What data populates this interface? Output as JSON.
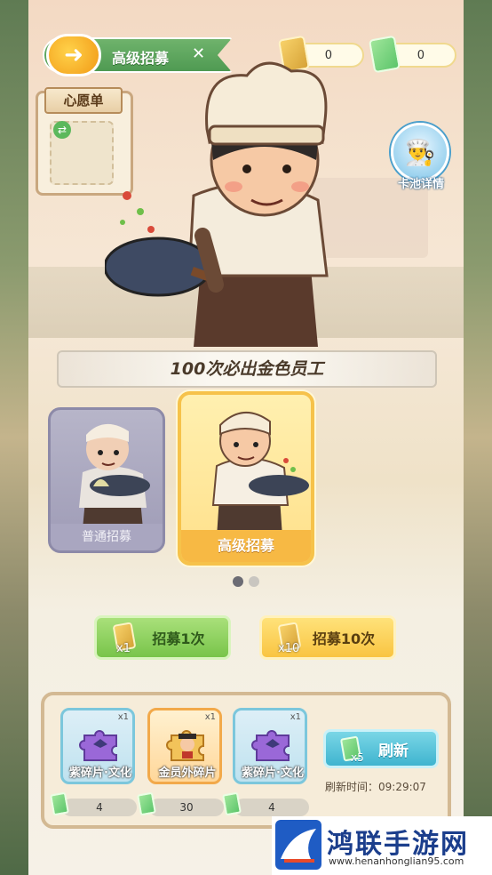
{
  "header": {
    "title": "高级招募",
    "back_icon": "fish-back-arrow-icon",
    "deco_icon": "utensils-icon"
  },
  "currency": {
    "gold_ticket_count": "0",
    "green_ticket_count": "0"
  },
  "wishlist": {
    "title": "心愿单",
    "swap_icon": "swap-icon"
  },
  "pool_detail": {
    "label": "卡池详情"
  },
  "banner": {
    "text": "100次必出金色员工"
  },
  "recruit_cards": {
    "normal": {
      "label": "普通招募"
    },
    "advanced": {
      "label": "高级招募"
    }
  },
  "pager": {
    "total": 2,
    "active": 0
  },
  "buttons": {
    "one": {
      "label": "招募1次",
      "qty": "x1"
    },
    "ten": {
      "label": "招募10次",
      "qty": "x10"
    }
  },
  "shop": {
    "items": [
      {
        "name": "紫碎片·文化",
        "count": "x1",
        "price": "4",
        "kind": "purple-puzzle-icon"
      },
      {
        "name": "金员外碎片",
        "count": "x1",
        "price": "30",
        "kind": "gold-employee-portrait-icon"
      },
      {
        "name": "紫碎片·文化",
        "count": "x1",
        "price": "4",
        "kind": "purple-puzzle-icon"
      }
    ],
    "refresh": {
      "label": "刷新",
      "qty": "x5"
    },
    "refresh_time": "刷新时间：09:29:07"
  },
  "watermark": {
    "title": "鸿联手游网",
    "url": "www.henanhonglian95.com"
  },
  "colors": {
    "green": "#78c44a",
    "gold": "#f9c441",
    "teal": "#3fb4cf",
    "purple": "#9e9bb6"
  }
}
